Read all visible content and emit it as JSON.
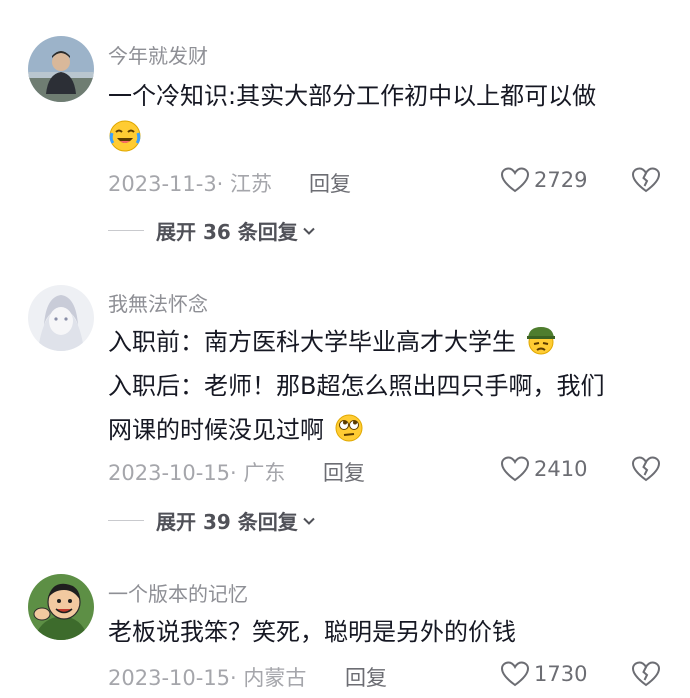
{
  "comments": [
    {
      "username": "今年就发财",
      "text_lines": [
        "一个冷知识:其实大部分工作初中以上都可以做",
        ""
      ],
      "text_emoji": "crying-laughing-emoji",
      "date_location": "2023-11-3· 江苏",
      "reply_label": "回复",
      "likes": "2729",
      "expand_label": "展开 36 条回复"
    },
    {
      "username": "我無法怀念",
      "text_lines": [
        "入职前：南方医科大学毕业高才大学生",
        "入职后：老师！那B超怎么照出四只手啊，我们",
        "网课的时候没见过啊"
      ],
      "text_emojis": [
        "soldier-helmet-emoji",
        "eye-roll-emoji"
      ],
      "date_location": "2023-10-15· 广东",
      "reply_label": "回复",
      "likes": "2410",
      "expand_label": "展开 39 条回复"
    },
    {
      "username": "一个版本的记忆",
      "text_lines": [
        "老板说我笨？笑死，聪明是另外的价钱"
      ],
      "date_location": "2023-10-15· 内蒙古",
      "reply_label": "回复",
      "likes": "1730"
    }
  ],
  "colors": {
    "text": "#161823",
    "username": "#8e8f95",
    "meta": "#a5a6ab",
    "action": "#6c6d73"
  }
}
